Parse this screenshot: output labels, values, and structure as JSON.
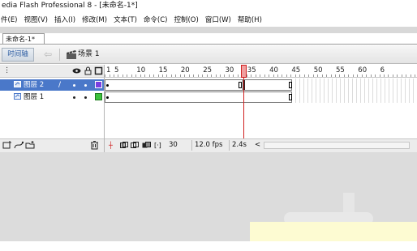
{
  "window": {
    "title": "edia Flash Professional 8 - [未命名-1*]"
  },
  "menu": [
    "件(E)",
    "视图(V)",
    "插入(I)",
    "修改(M)",
    "文本(T)",
    "命令(C)",
    "控制(O)",
    "窗口(W)",
    "帮助(H)"
  ],
  "document": {
    "tab_label": "未命名-1*"
  },
  "scene_bar": {
    "timeline_toggle": "时间轴",
    "back_icon": "arrow-left-icon",
    "scene_icon": "clapperboard-icon",
    "scene_name": "场景 1"
  },
  "layer_header": {
    "eye_icon": "eye-icon",
    "lock_icon": "lock-icon",
    "outline_icon": "outline-square-icon"
  },
  "layers": [
    {
      "name": "图层 2",
      "selected": true,
      "color": "#7a3fe0",
      "editing": "/"
    },
    {
      "name": "图层 1",
      "selected": false,
      "color": "#3cc23c",
      "editing": ""
    }
  ],
  "layer_footer": {
    "icons": [
      "insert-layer-icon",
      "add-motion-guide-icon",
      "insert-folder-icon",
      "trash-icon"
    ]
  },
  "ruler": {
    "labels": [
      "1",
      "5",
      "10",
      "15",
      "20",
      "25",
      "30",
      "35",
      "40",
      "45",
      "50",
      "55",
      "60",
      "6"
    ]
  },
  "timeline_footer": {
    "icons": [
      "center-frame-icon",
      "onion-skin-icon",
      "onion-outline-icon",
      "edit-multiple-icon",
      "onion-markers-icon"
    ],
    "current_frame": "30",
    "fps": "12.0 fps",
    "elapsed": "2.4s",
    "scroll_left": "<"
  },
  "colors": {
    "selected_row": "#4a78c9",
    "playhead": "#d02020",
    "stage": "#dcdcdc"
  }
}
